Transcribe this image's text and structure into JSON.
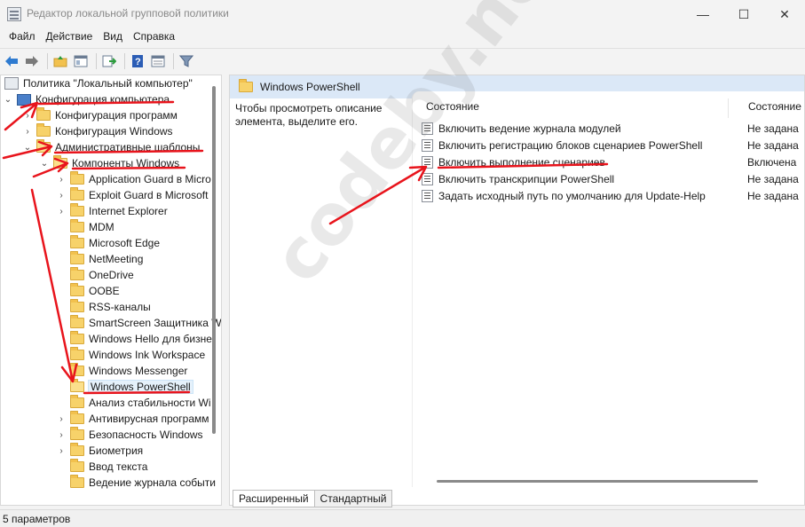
{
  "window": {
    "title": "Редактор локальной групповой политики",
    "minimize_glyph": "—",
    "maximize_glyph": "☐",
    "close_glyph": "✕"
  },
  "menu": [
    "Файл",
    "Действие",
    "Вид",
    "Справка"
  ],
  "toolbar": {
    "icons": [
      "back-arrow-icon",
      "forward-arrow-icon",
      "folder-up-icon",
      "show-hide-tree-icon",
      "export-list-icon",
      "help-icon",
      "properties-icon",
      "filter-icon"
    ]
  },
  "tree": {
    "root": "Политика \"Локальный компьютер\"",
    "computer_config": "Конфигурация компьютера",
    "software_settings": "Конфигурация программ",
    "windows_settings": "Конфигурация Windows",
    "admin_templates": "Административные шаблоны",
    "windows_components": "Компоненты Windows",
    "components": [
      "Application Guard в Micro",
      "Exploit Guard в Microsoft",
      "Internet Explorer",
      "MDM",
      "Microsoft Edge",
      "NetMeeting",
      "OneDrive",
      "OOBE",
      "RSS-каналы",
      "SmartScreen Защитника W",
      "Windows Hello для бизне",
      "Windows Ink Workspace",
      "Windows Messenger",
      "Windows PowerShell",
      "Анализ стабильности Wi",
      "Антивирусная программ",
      "Безопасность Windows",
      "Биометрия",
      "Ввод текста",
      "Ведение журнала событи"
    ]
  },
  "right": {
    "header_title": "Windows PowerShell",
    "description": "Чтобы просмотреть описание элемента, выделите его.",
    "col_setting": "Состояние",
    "col_state": "Состояние",
    "settings": [
      {
        "name": "Включить ведение журнала модулей",
        "state": "Не задана"
      },
      {
        "name": "Включить регистрацию блоков сценариев PowerShell",
        "state": "Не задана"
      },
      {
        "name": "Включить выполнение сценариев",
        "state": "Включена"
      },
      {
        "name": "Включить транскрипции PowerShell",
        "state": "Не задана"
      },
      {
        "name": "Задать исходный путь по умолчанию для Update-Help",
        "state": "Не задана"
      }
    ]
  },
  "tabs": [
    "Расширенный",
    "Стандартный"
  ],
  "status": "5 параметров",
  "watermark": "codeby.net",
  "colors": {
    "annotation": "#e8141c",
    "header_bg": "#dbe8f7",
    "folder": "#f7d26a"
  }
}
